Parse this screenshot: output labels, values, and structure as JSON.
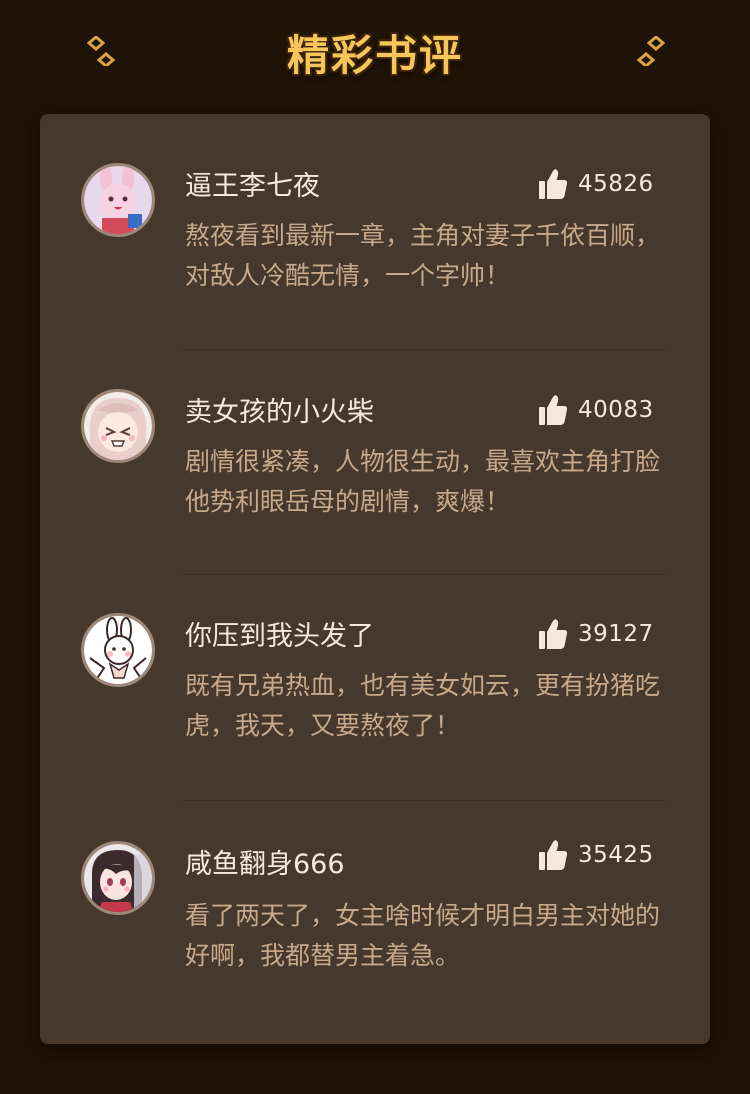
{
  "header": {
    "title": "精彩书评"
  },
  "colors": {
    "background": "#1f1207",
    "card": "#46382c",
    "title": "#f7c65a",
    "name": "#f4eadc",
    "comment": "#c6a98d"
  },
  "reviews": [
    {
      "name": "逼王李七夜",
      "likes": "45826",
      "text": "熬夜看到最新一章，主角对妻子千依百顺，对敌人冷酷无情，一个字帅！",
      "avatar_icon": "pink-bunny-avatar"
    },
    {
      "name": "卖女孩的小火柴",
      "likes": "40083",
      "text": "剧情很紧凑，人物很生动，最喜欢主角打脸他势利眼岳母的剧情，爽爆！",
      "avatar_icon": "crying-girl-avatar"
    },
    {
      "name": "你压到我头发了",
      "likes": "39127",
      "text": "既有兄弟热血，也有美女如云，更有扮猪吃虎，我天，又要熬夜了！",
      "avatar_icon": "white-rabbit-avatar"
    },
    {
      "name": "咸鱼翻身666",
      "likes": "35425",
      "text": "看了两天了，女主啥时候才明白男主对她的好啊，我都替男主着急。",
      "avatar_icon": "anime-girl-avatar"
    }
  ]
}
